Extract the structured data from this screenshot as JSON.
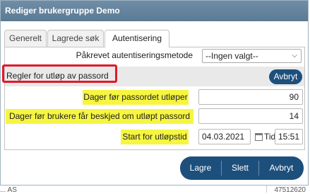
{
  "dialog": {
    "title": "Rediger brukergruppe Demo"
  },
  "tabs": [
    {
      "label": "Generelt",
      "active": false
    },
    {
      "label": "Lagrede søk",
      "active": false
    },
    {
      "label": "Autentisering",
      "active": true
    }
  ],
  "auth": {
    "method_label": "Påkrevet autentiseringsmetode",
    "method_value": "--Ingen valgt--"
  },
  "section": {
    "title": "Regler for utløp av passord",
    "cancel_label": "Avbryt"
  },
  "fields": {
    "days_before_expiry_label": "Dager før passordet utløper",
    "days_before_expiry_value": "90",
    "days_notice_label": "Dager før brukere får beskjed om utløpt passord",
    "days_notice_value": "14",
    "start_label": "Start for utløpstid",
    "start_date": "04.03.2021",
    "time_label": "Tid",
    "start_time": "15:51"
  },
  "footer": {
    "save_label": "Lagre",
    "delete_label": "Slett",
    "cancel_label": "Avbryt"
  },
  "background": {
    "left_text": "... AS",
    "right_text": "47512620"
  },
  "colors": {
    "titlebar": "#5f7e97",
    "button": "#1d4f7c",
    "highlight": "#f5f542",
    "annotation": "#e01a2b"
  }
}
